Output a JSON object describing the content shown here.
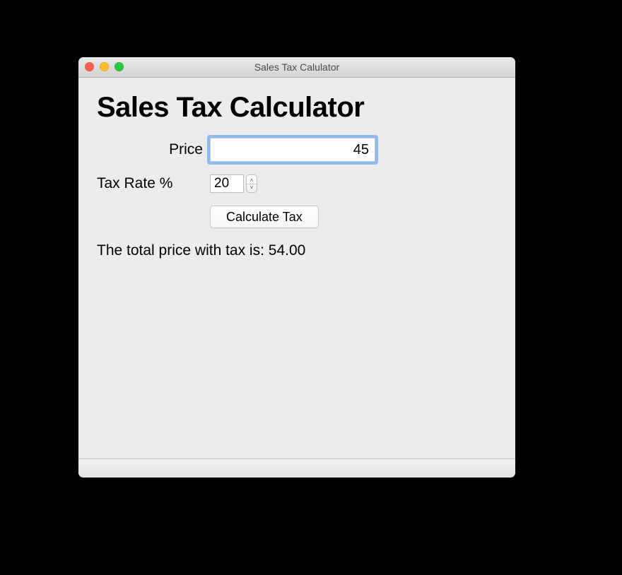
{
  "window": {
    "title": "Sales Tax Calulator"
  },
  "heading": "Sales Tax Calculator",
  "price": {
    "label": "Price",
    "value": "45"
  },
  "taxRate": {
    "label": "Tax Rate %",
    "value": "20"
  },
  "buttons": {
    "calculate": "Calculate Tax"
  },
  "result": {
    "text": "The total price with tax is: 54.00"
  }
}
